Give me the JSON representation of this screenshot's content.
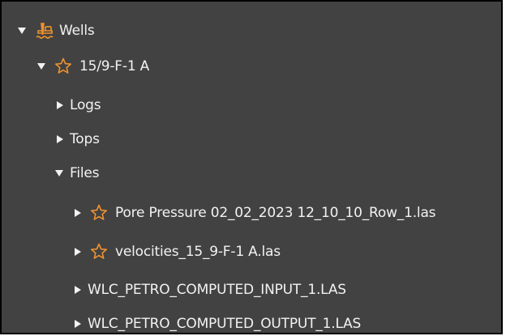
{
  "colors": {
    "panel_background": "#424242",
    "text": "#f2f2f2",
    "accent": "#f0922f",
    "border": "#000000"
  },
  "tree": {
    "wells": {
      "label": "Wells",
      "icon": "oil-rig-icon",
      "expanded": true
    },
    "well": {
      "label": "15/9-F-1 A",
      "icon": "star-icon",
      "expanded": true
    },
    "logs": {
      "label": "Logs",
      "expanded": false
    },
    "tops": {
      "label": "Tops",
      "expanded": false
    },
    "files": {
      "label": "Files",
      "expanded": true,
      "items": [
        {
          "label": "Pore Pressure 02_02_2023 12_10_10_Row_1.las",
          "icon": "star-icon",
          "expanded": false
        },
        {
          "label": "velocities_15_9-F-1 A.las",
          "icon": "star-icon",
          "expanded": false
        },
        {
          "label": "WLC_PETRO_COMPUTED_INPUT_1.LAS",
          "icon": "",
          "expanded": false
        },
        {
          "label": "WLC_PETRO_COMPUTED_OUTPUT_1.LAS",
          "icon": "",
          "expanded": false
        }
      ]
    }
  }
}
